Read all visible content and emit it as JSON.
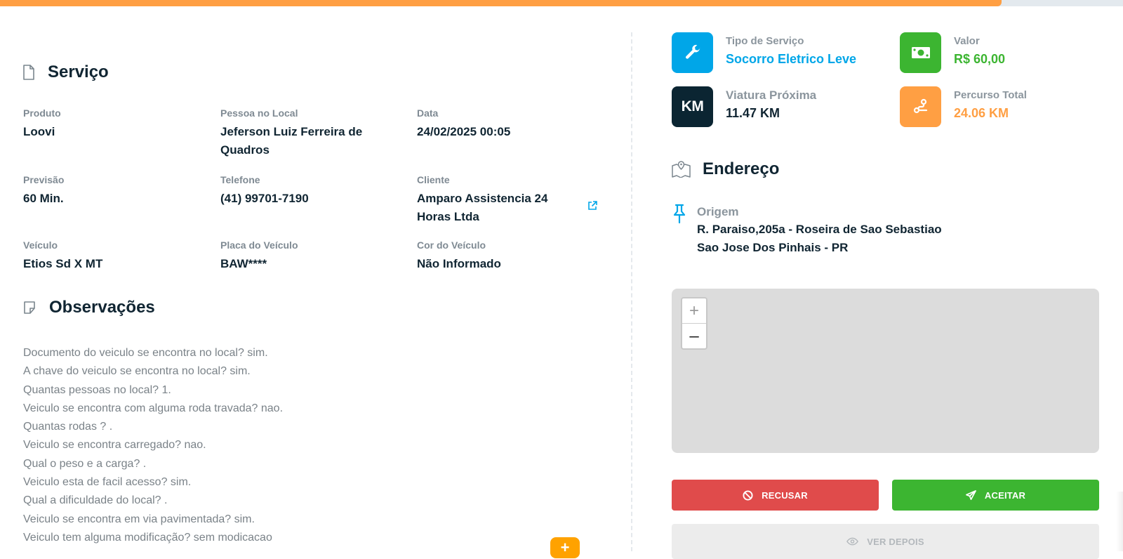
{
  "progress": {
    "value_percent": 89.2,
    "color": "#ff9f43",
    "track_color": "#e3e9ee"
  },
  "servico": {
    "title": "Serviço",
    "fields": {
      "produto": {
        "label": "Produto",
        "value": "Loovi"
      },
      "pessoa": {
        "label": "Pessoa no Local",
        "value": "Jeferson Luiz Ferreira de Quadros"
      },
      "data": {
        "label": "Data",
        "value": "24/02/2025 00:05"
      },
      "previsao": {
        "label": "Previsão",
        "value": "60 Min."
      },
      "telefone": {
        "label": "Telefone",
        "value": "(41) 99701-7190"
      },
      "cliente": {
        "label": "Cliente",
        "value": "Amparo Assistencia 24 Horas Ltda"
      },
      "veiculo": {
        "label": "Veículo",
        "value": "Etios Sd X MT"
      },
      "placa": {
        "label": "Placa do Veículo",
        "value": "BAW****"
      },
      "cor": {
        "label": "Cor do Veículo",
        "value": "Não Informado"
      }
    }
  },
  "observacoes": {
    "title": "Observações",
    "lines": [
      "Documento do veiculo se encontra no local? sim.",
      "A chave do veiculo se encontra no local? sim.",
      "Quantas pessoas no local? 1.",
      "Veiculo se encontra com alguma roda travada? nao.",
      "Quantas rodas ? .",
      "Veiculo se encontra carregado? nao.",
      "Qual o peso e a carga? .",
      "Veiculo esta de facil acesso? sim.",
      "Qual a dificuldade do local? .",
      "Veiculo se encontra em via pavimentada? sim.",
      "Veiculo tem alguma modificação? sem modicacao"
    ],
    "fab_label": "+"
  },
  "cards": {
    "tipo": {
      "title": "Tipo de Serviço",
      "value": "Socorro Eletrico Leve",
      "color": "#00a6e8",
      "icon": "wrench-icon"
    },
    "valor": {
      "title": "Valor",
      "value": "R$ 60,00",
      "color": "#3cb531",
      "icon": "money-icon"
    },
    "viatura": {
      "title": "Viatura Próxima",
      "value": "11.47 KM",
      "color": "#102532",
      "tile_text": "KM"
    },
    "percurso": {
      "title": "Percurso Total",
      "value": "24.06 KM",
      "color": "#ff9f43",
      "icon": "route-icon"
    }
  },
  "endereco": {
    "title": "Endereço",
    "origem_label": "Origem",
    "line1": "R. Paraiso,205a - Roseira de Sao Sebastiao",
    "line2": "Sao Jose Dos Pinhais - PR"
  },
  "map": {
    "zoom_in": "+",
    "zoom_out": "–"
  },
  "actions": {
    "recusar": "Recusar",
    "aceitar": "Aceitar",
    "ver_depois": "Ver depois"
  }
}
